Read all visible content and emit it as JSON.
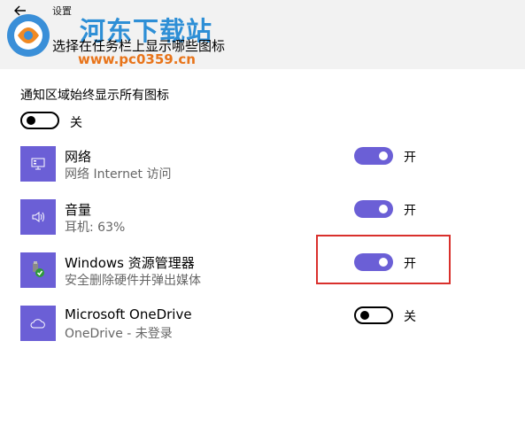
{
  "window": {
    "back_icon": "back-arrow-icon",
    "title": "设置"
  },
  "page": {
    "title": "选择在任务栏上显示哪些图标"
  },
  "watermark": {
    "name": "河东下载站",
    "url": "www.pc0359.cn"
  },
  "always_show": {
    "label": "通知区域始终显示所有图标",
    "state": "关",
    "on": false
  },
  "apps": [
    {
      "icon": "network-icon",
      "name": "网络",
      "subtitle": "网络 Internet 访问",
      "state": "开",
      "on": true
    },
    {
      "icon": "speaker-icon",
      "name": "音量",
      "subtitle": "耳机: 63%",
      "state": "开",
      "on": true
    },
    {
      "icon": "usb-safely-remove-icon",
      "name": "Windows 资源管理器",
      "subtitle": "安全删除硬件并弹出媒体",
      "state": "开",
      "on": true
    },
    {
      "icon": "cloud-icon",
      "name": "Microsoft OneDrive",
      "subtitle": "OneDrive - 未登录",
      "state": "关",
      "on": false
    }
  ],
  "colors": {
    "accent": "#6b5fd6",
    "highlight": "#d9302c",
    "header_bg": "#f2f2f2"
  }
}
